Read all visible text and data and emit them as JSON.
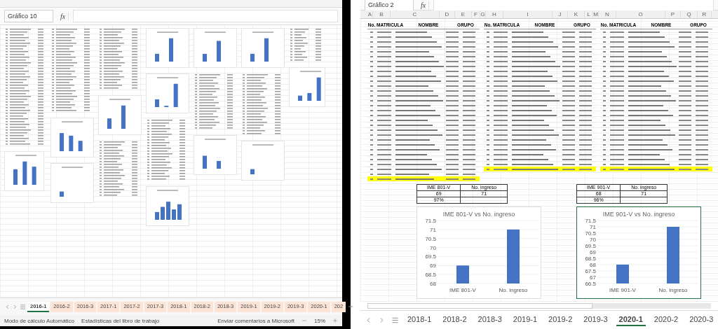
{
  "left_window": {
    "name_box": "Gráfico 10",
    "formula_icon": "fx",
    "sheet_tabs": [
      {
        "label": "2016-1",
        "selected": true
      },
      {
        "label": "2016-2",
        "selected": false
      },
      {
        "label": "2016-3",
        "selected": false
      },
      {
        "label": "2017-1",
        "selected": false
      },
      {
        "label": "2017-2",
        "selected": false
      },
      {
        "label": "2017-3",
        "selected": false
      },
      {
        "label": "2018-1",
        "selected": false
      },
      {
        "label": "2018-2",
        "selected": false
      },
      {
        "label": "2018-3",
        "selected": false
      },
      {
        "label": "2019-1",
        "selected": false
      },
      {
        "label": "2019-2",
        "selected": false
      },
      {
        "label": "2019-3",
        "selected": false
      },
      {
        "label": "2020-1",
        "selected": false
      },
      {
        "label": "202",
        "selected": false
      }
    ],
    "status_bar": {
      "mode": "Modo de cálculo Automático",
      "stats": "Estadísticas del libro de trabajo",
      "feedback": "Enviar comentarios a Microsoft",
      "zoom": "15%"
    }
  },
  "right_window": {
    "name_box": "Gráfico 2",
    "formula_icon": "fx",
    "columns": [
      "A",
      "B",
      "C",
      "D",
      "E",
      "F",
      "G",
      "H",
      "I",
      "J",
      "K",
      "L",
      "M",
      "N",
      "O",
      "P",
      "Q",
      "R"
    ],
    "blocks": [
      {
        "headers": [
          "No. MATRICULA",
          "NOMBRE",
          "GRUPO"
        ]
      },
      {
        "headers": [
          "No. MATRICULA",
          "NOMBRE",
          "GRUPO"
        ]
      },
      {
        "headers": [
          "No. MATRICULA",
          "NOMBRE",
          "GRUPO"
        ]
      }
    ],
    "charts": [
      {
        "selected": false,
        "summary": {
          "header": [
            "IME 801-V",
            "No. ingreso"
          ],
          "rows": [
            [
              "69",
              "71"
            ],
            [
              "97%"
            ]
          ]
        },
        "chart_data": {
          "type": "bar",
          "title": "IME 801-V vs No. ingreso",
          "categories": [
            "IME 801-V",
            "No. ingreso"
          ],
          "values": [
            69,
            71
          ],
          "grid": true,
          "ylim": [
            68,
            71.5
          ],
          "yticks": [
            68,
            68.5,
            69,
            69.5,
            70,
            70.5,
            71,
            71.5
          ]
        }
      },
      {
        "selected": true,
        "summary": {
          "header": [
            "IME 901-V",
            "No. ingreso"
          ],
          "rows": [
            [
              "68",
              "71"
            ],
            [
              "96%"
            ]
          ]
        },
        "chart_data": {
          "type": "bar",
          "title": "IME 901-V vs No. ingreso",
          "categories": [
            "IME 901-V",
            "No. ingreso"
          ],
          "values": [
            68,
            71
          ],
          "grid": true,
          "ylim": [
            66.5,
            71.5
          ],
          "yticks": [
            66.5,
            67,
            67.5,
            68,
            68.5,
            69,
            69.5,
            70,
            70.5,
            71,
            71.5
          ]
        }
      }
    ],
    "sheet_tabs": [
      {
        "label": "2018-1",
        "selected": false
      },
      {
        "label": "2018-2",
        "selected": false
      },
      {
        "label": "2018-3",
        "selected": false
      },
      {
        "label": "2019-1",
        "selected": false
      },
      {
        "label": "2019-2",
        "selected": false
      },
      {
        "label": "2019-3",
        "selected": false
      },
      {
        "label": "2020-1",
        "selected": true
      },
      {
        "label": "2020-2",
        "selected": false
      },
      {
        "label": "2020-3",
        "selected": false
      }
    ]
  }
}
